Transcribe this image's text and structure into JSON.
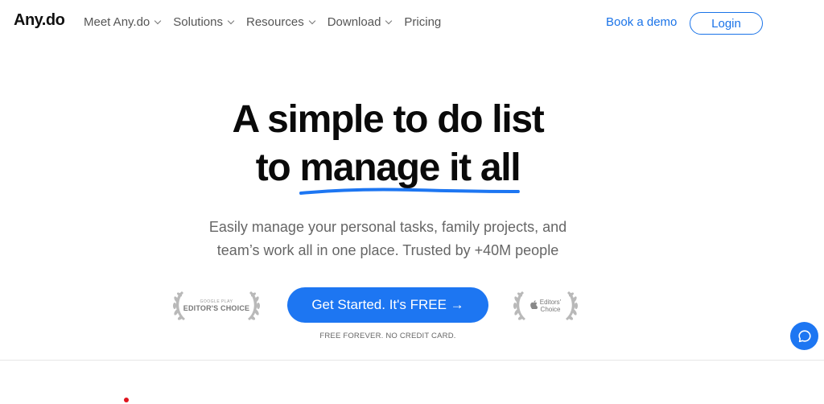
{
  "nav": {
    "logo": "Any.do",
    "menu": [
      {
        "label": "Meet Any.do",
        "has_dropdown": true
      },
      {
        "label": "Solutions",
        "has_dropdown": true
      },
      {
        "label": "Resources",
        "has_dropdown": true
      },
      {
        "label": "Download",
        "has_dropdown": true
      },
      {
        "label": "Pricing",
        "has_dropdown": false
      }
    ],
    "book_demo": "Book a demo",
    "login": "Login"
  },
  "hero": {
    "headline_line1": "A simple to do list",
    "headline_line2_prefix": "to ",
    "headline_line2_highlight": "manage it all",
    "subtitle_line1": "Easily manage your personal tasks, family projects, and",
    "subtitle_line2": "team’s work all in one place. Trusted by +40M people",
    "cta": "Get Started. It's FREE →",
    "cta_note": "FREE FOREVER. NO CREDIT CARD.",
    "badge_google_small": "GOOGLE PLAY",
    "badge_google_big": "EDITOR'S CHOICE",
    "badge_apple_line1": "Editors'",
    "badge_apple_line2": "Choice"
  },
  "colors": {
    "accent": "#1d76f2",
    "link": "#1a73e8",
    "headline": "#0a0a0a",
    "red_dot": "#e0141e"
  },
  "icons": {
    "chat": "chat-bubble-icon",
    "apple": "apple-logo-icon",
    "laurel": "laurel-wreath-icon"
  }
}
